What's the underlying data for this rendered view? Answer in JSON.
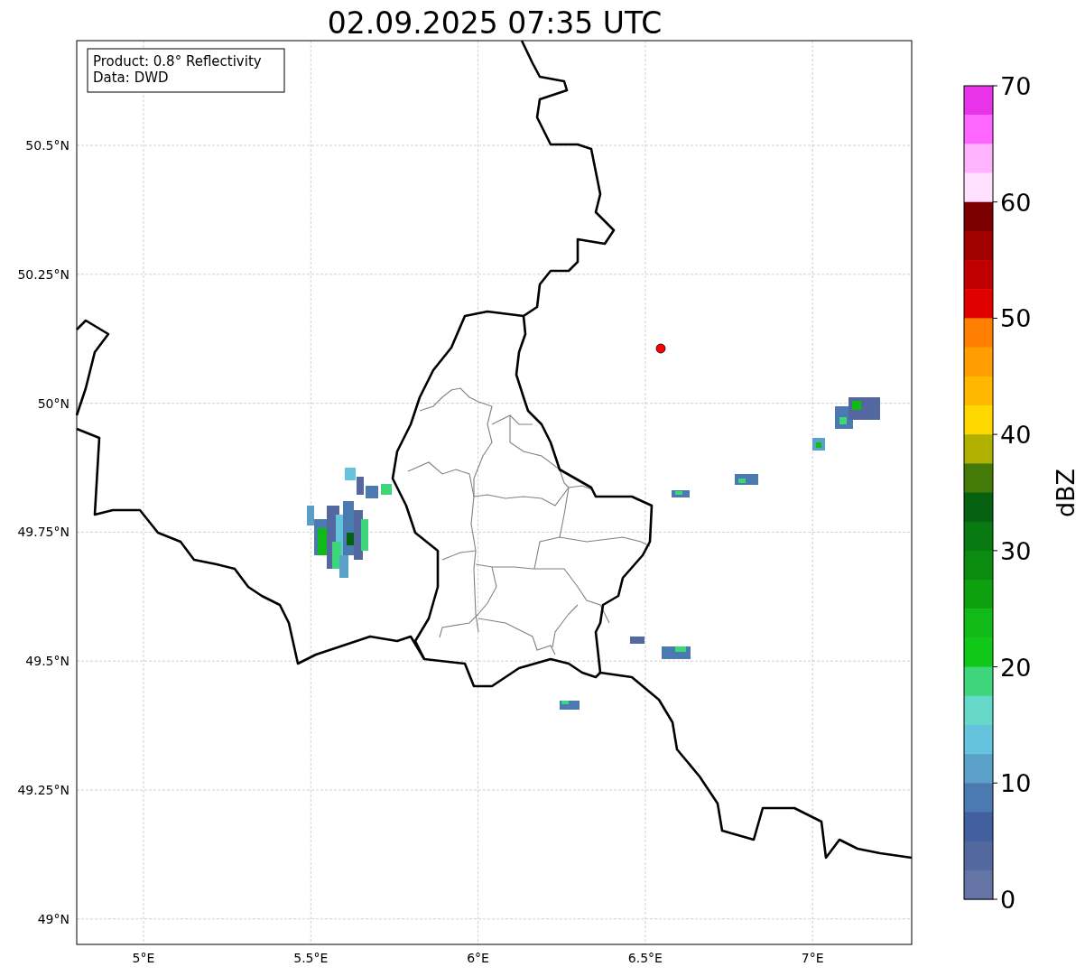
{
  "title": "02.09.2025 07:35 UTC",
  "info_box": {
    "lines": [
      "Product: 0.8° Reflectivity",
      "Data: DWD"
    ]
  },
  "map": {
    "x_ticks": [
      "5°E",
      "5.5°E",
      "6°E",
      "6.5°E",
      "7°E"
    ],
    "y_ticks": [
      "50.5°N",
      "50.25°N",
      "50°N",
      "49.75°N",
      "49.5°N",
      "49.25°N",
      "49°N"
    ]
  },
  "colorbar": {
    "label": "dBZ",
    "ticks": [
      "70",
      "60",
      "50",
      "40",
      "30",
      "20",
      "10",
      "0"
    ],
    "segments": [
      {
        "color": "#e833e8"
      },
      {
        "color": "#ff66ff"
      },
      {
        "color": "#ffb3ff"
      },
      {
        "color": "#ffe0ff"
      },
      {
        "color": "#7d0000"
      },
      {
        "color": "#a00000"
      },
      {
        "color": "#c00000"
      },
      {
        "color": "#e10000"
      },
      {
        "color": "#ff8000"
      },
      {
        "color": "#ff9c00"
      },
      {
        "color": "#ffb700"
      },
      {
        "color": "#ffd800"
      },
      {
        "color": "#b0b000"
      },
      {
        "color": "#447a08"
      },
      {
        "color": "#056010"
      },
      {
        "color": "#087810"
      },
      {
        "color": "#0b8c10"
      },
      {
        "color": "#0fa010"
      },
      {
        "color": "#10bb18"
      },
      {
        "color": "#10c818"
      },
      {
        "color": "#3ed67a"
      },
      {
        "color": "#66d8c8"
      },
      {
        "color": "#66c3dd"
      },
      {
        "color": "#5aa0c8"
      },
      {
        "color": "#4a7ab0"
      },
      {
        "color": "#4260a0"
      },
      {
        "color": "#5468a0"
      },
      {
        "color": "#6474a4"
      }
    ]
  }
}
